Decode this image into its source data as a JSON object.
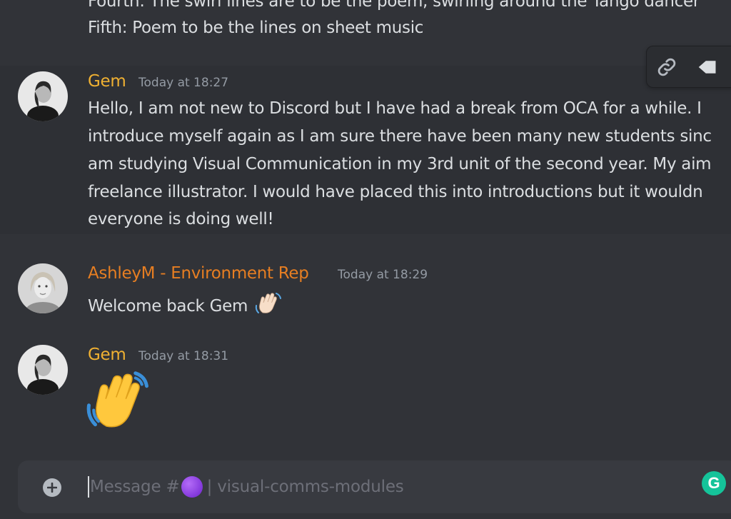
{
  "channel": {
    "composer_placeholder_prefix": "Message #",
    "composer_placeholder_suffix": " | visual-comms-modules"
  },
  "previous_message": {
    "lines": [
      "Fourth: The swirl lines are to be the poem, swirling around the Tango dancer",
      "Fifth: Poem to be the lines on sheet music"
    ]
  },
  "messages": [
    {
      "author": "Gem",
      "author_color": "#f0b132",
      "timestamp": "Today at 18:27",
      "lines": [
        "Hello, I am not new to Discord but I have had a break from OCA for a while. I",
        "introduce myself again as I am sure there have been many new students sinc",
        "am studying Visual Communication in my 3rd unit of the second year. My aim",
        "freelance illustrator. I would have placed this into introductions but it wouldn",
        "everyone is doing well!"
      ]
    },
    {
      "author": "AshleyM - Environment Rep",
      "author_color": "#e67e22",
      "timestamp": "Today at 18:29",
      "text": "Welcome back Gem",
      "emoji": "waving-hand-light-skin"
    },
    {
      "author": "Gem",
      "author_color": "#f0b132",
      "timestamp": "Today at 18:31",
      "emoji": "waving-hand-large"
    }
  ],
  "toolbar": {
    "icons": [
      "link-icon",
      "reply-icon"
    ]
  },
  "colors": {
    "background": "#313338",
    "hover_background": "#2e3035",
    "composer_background": "#383a40",
    "grammarly": "#15c39a"
  }
}
